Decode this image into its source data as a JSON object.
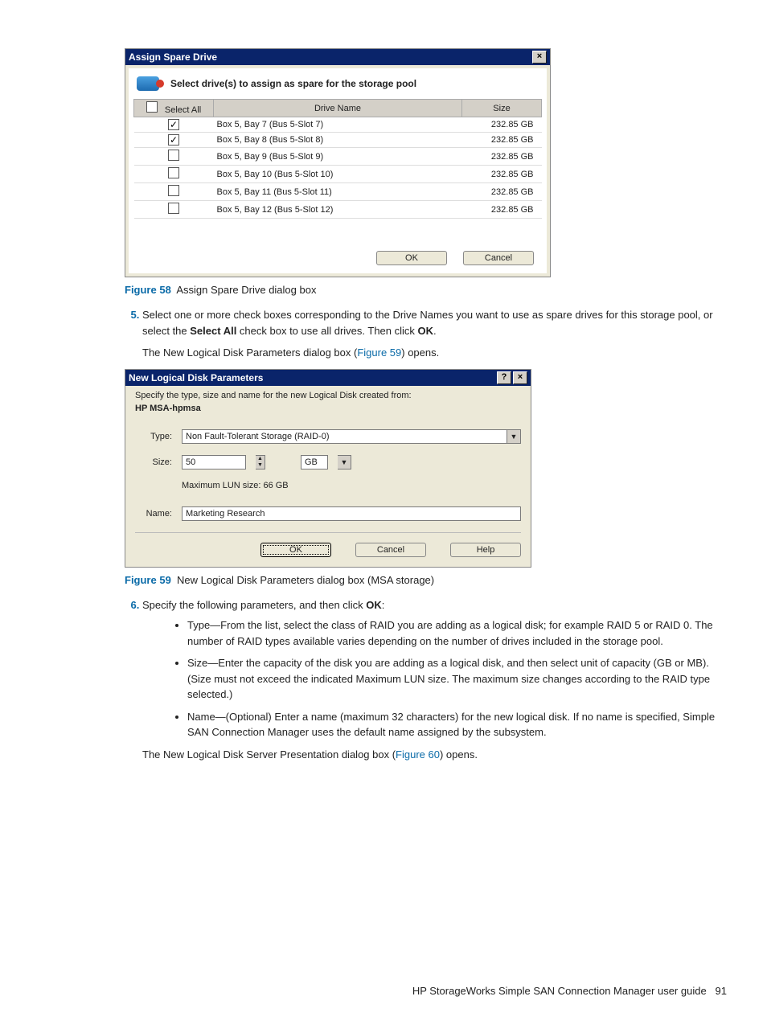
{
  "dialog1": {
    "title": "Assign Spare Drive",
    "instruction": "Select drive(s) to assign as spare for the storage pool",
    "columns": {
      "selectAll": "Select All",
      "driveName": "Drive Name",
      "size": "Size"
    },
    "rows": [
      {
        "checked": true,
        "name": "Box 5, Bay 7 (Bus 5-Slot 7)",
        "size": "232.85 GB"
      },
      {
        "checked": true,
        "name": "Box 5, Bay 8 (Bus 5-Slot 8)",
        "size": "232.85 GB"
      },
      {
        "checked": false,
        "name": "Box 5, Bay 9 (Bus 5-Slot 9)",
        "size": "232.85 GB"
      },
      {
        "checked": false,
        "name": "Box 5, Bay 10 (Bus 5-Slot 10)",
        "size": "232.85 GB"
      },
      {
        "checked": false,
        "name": "Box 5, Bay 11 (Bus 5-Slot 11)",
        "size": "232.85 GB"
      },
      {
        "checked": false,
        "name": "Box 5, Bay 12 (Bus 5-Slot 12)",
        "size": "232.85 GB"
      }
    ],
    "ok": "OK",
    "cancel": "Cancel"
  },
  "fig58": {
    "label": "Figure 58",
    "text": "Assign Spare Drive dialog box"
  },
  "step5": {
    "text_a": "Select one or more check boxes corresponding to the Drive Names you want to use as spare drives for this storage pool, or select the ",
    "bold_b": "Select All",
    "text_c": " check box to use all drives. Then click ",
    "bold_d": "OK",
    "text_e": "."
  },
  "step5_after": {
    "a": "The New Logical Disk Parameters dialog box (",
    "link": "Figure 59",
    "b": ") opens."
  },
  "dialog2": {
    "title": "New Logical Disk Parameters",
    "specify": "Specify the type, size and name for the new Logical Disk created from:",
    "pool": "HP MSA-hpmsa",
    "labels": {
      "type": "Type:",
      "size": "Size:",
      "name": "Name:"
    },
    "typeValue": "Non Fault-Tolerant Storage (RAID-0)",
    "sizeValue": "50",
    "sizeUnit": "GB",
    "maxLun": "Maximum LUN size: 66 GB",
    "nameValue": "Marketing Research",
    "ok": "OK",
    "cancel": "Cancel",
    "help": "Help"
  },
  "fig59": {
    "label": "Figure 59",
    "text": "New Logical Disk Parameters dialog box (MSA storage)"
  },
  "step6": {
    "lead_a": "Specify the following parameters, and then click ",
    "lead_b": "OK",
    "lead_c": ":",
    "bullets": [
      "Type—From the list, select the class of RAID you are adding as a logical disk; for example RAID 5 or RAID 0. The number of RAID types available varies depending on the number of drives included in the storage pool.",
      "Size—Enter the capacity of the disk you are adding as a logical disk, and then select unit of capacity (GB or MB). (Size must not exceed the indicated Maximum LUN size. The maximum size changes according to the RAID type selected.)",
      "Name—(Optional) Enter a name (maximum 32 characters) for the new logical disk. If no name is specified, Simple SAN Connection Manager uses the default name assigned by the subsystem."
    ],
    "tail_a": "The New Logical Disk Server Presentation dialog box (",
    "tail_link": "Figure 60",
    "tail_b": ") opens."
  },
  "footer": {
    "text": "HP StorageWorks Simple SAN Connection Manager user guide",
    "page": "91"
  }
}
